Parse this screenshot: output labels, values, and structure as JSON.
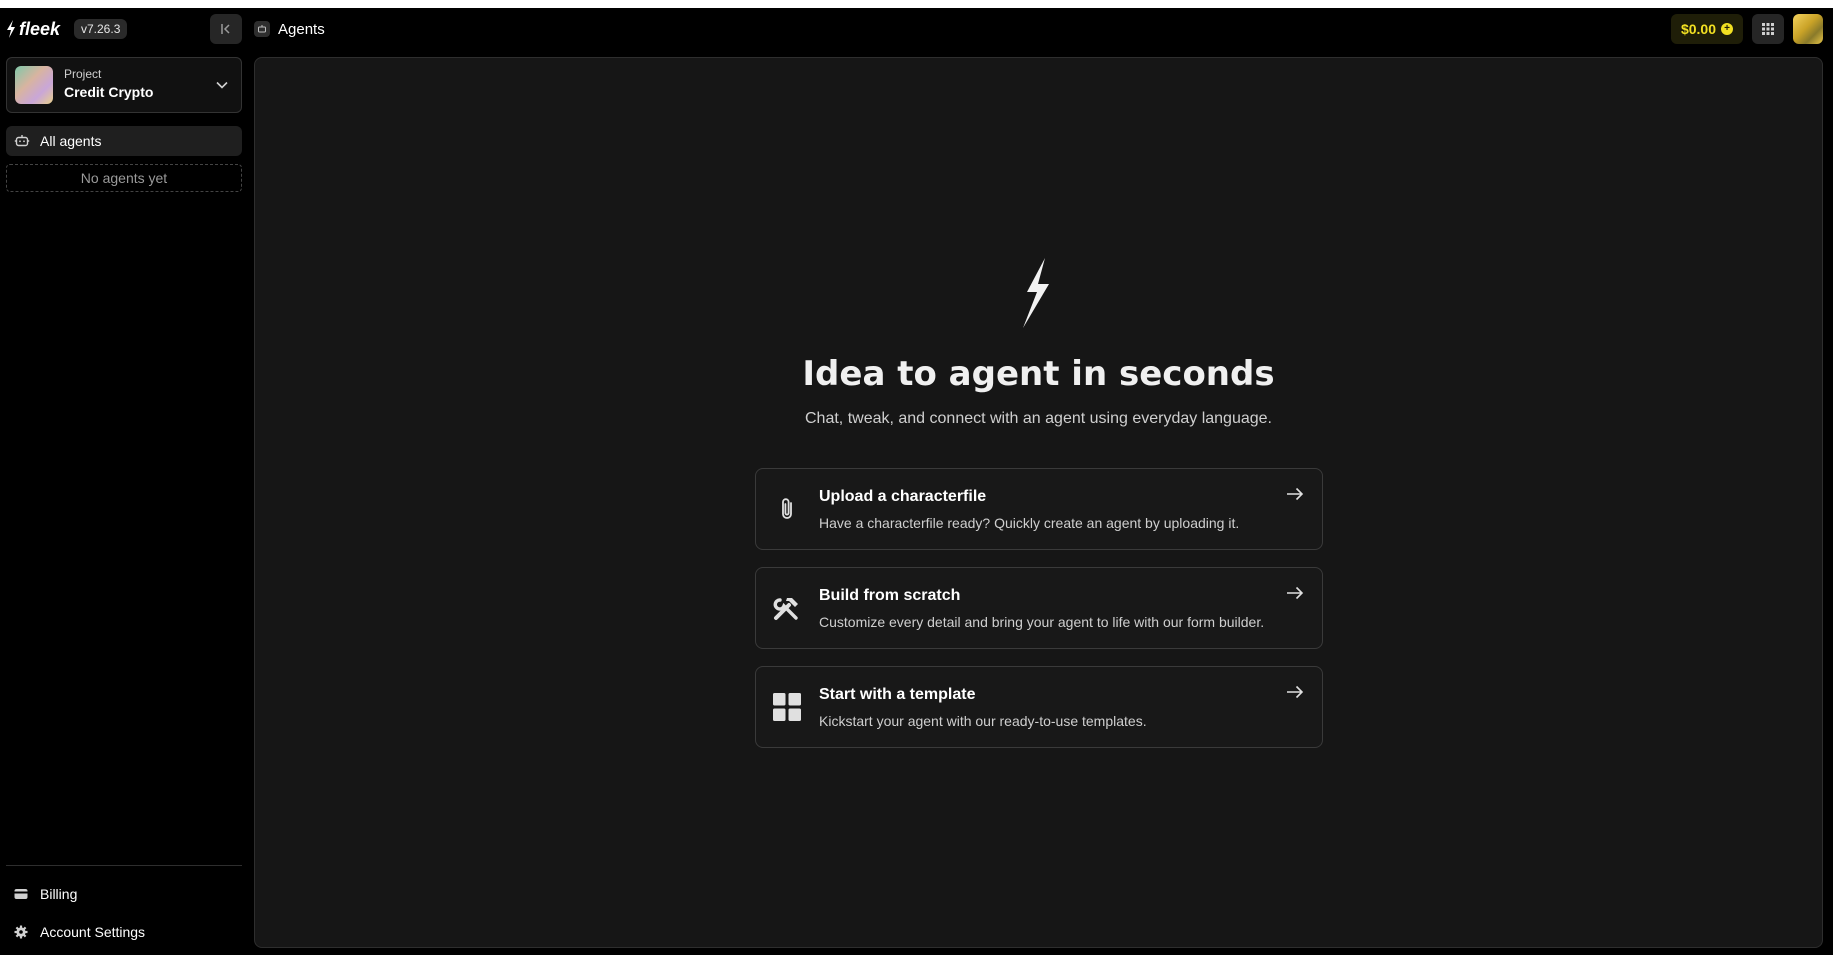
{
  "app": {
    "brand": "fleek",
    "version": "v7.26.3",
    "accent": "#f2e022"
  },
  "header": {
    "breadcrumb": "Agents",
    "balance": "$0.00",
    "icons": {
      "collapse": "collapse-sidebar-icon",
      "agents": "robot-icon",
      "coin": "coin-icon",
      "apps": "grid-icon"
    }
  },
  "sidebar": {
    "project": {
      "caption": "Project",
      "name": "Credit Crypto"
    },
    "nav": {
      "all_agents": "All agents",
      "empty": "No agents yet"
    },
    "bottom": {
      "billing": "Billing",
      "settings": "Account Settings"
    }
  },
  "main": {
    "title": "Idea to agent in seconds",
    "subtitle": "Chat, tweak, and connect with an agent using everyday language.",
    "options": [
      {
        "title": "Upload a characterfile",
        "description": "Have a characterfile ready? Quickly create an agent by uploading it.",
        "icon": "paperclip-icon"
      },
      {
        "title": "Build from scratch",
        "description": "Customize every detail and bring your agent to life with our form builder.",
        "icon": "tools-icon"
      },
      {
        "title": "Start with a template",
        "description": "Kickstart your agent with our ready-to-use templates.",
        "icon": "template-grid-icon"
      }
    ]
  }
}
